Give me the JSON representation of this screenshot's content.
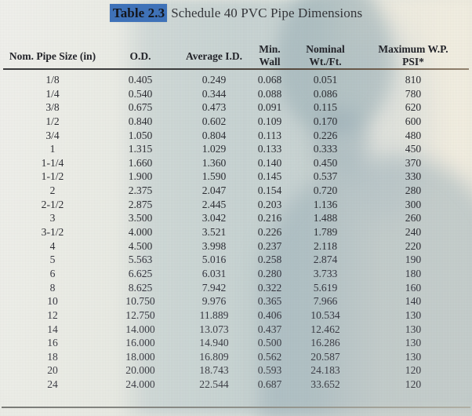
{
  "document": {
    "title_tag": "Table 2.3",
    "title_rest": "Schedule 40 PVC Pipe Dimensions",
    "highlight_color": "#3f72b8",
    "rule_color": "#2a2b2c"
  },
  "table": {
    "columns": [
      {
        "id": "size",
        "label": "Nom. Pipe Size (in)",
        "label_line1": "Nom. Pipe Size (in)",
        "label_line2": ""
      },
      {
        "id": "od",
        "label": "O.D.",
        "label_line1": "O.D.",
        "label_line2": ""
      },
      {
        "id": "id",
        "label": "Average I.D.",
        "label_line1": "Average I.D.",
        "label_line2": ""
      },
      {
        "id": "wall",
        "label": "Min. Wall",
        "label_line1": "Min.",
        "label_line2": "Wall"
      },
      {
        "id": "wt",
        "label": "Nominal Wt./Ft.",
        "label_line1": "Nominal",
        "label_line2": "Wt./Ft."
      },
      {
        "id": "psi",
        "label": "Maximum W.P. PSI*",
        "label_line1": "Maximum W.P.",
        "label_line2": "PSI*"
      }
    ],
    "rows": [
      {
        "size": "1/8",
        "od": "0.405",
        "id": "0.249",
        "wall": "0.068",
        "wt": "0.051",
        "psi": "810"
      },
      {
        "size": "1/4",
        "od": "0.540",
        "id": "0.344",
        "wall": "0.088",
        "wt": "0.086",
        "psi": "780"
      },
      {
        "size": "3/8",
        "od": "0.675",
        "id": "0.473",
        "wall": "0.091",
        "wt": "0.115",
        "psi": "620"
      },
      {
        "size": "1/2",
        "od": "0.840",
        "id": "0.602",
        "wall": "0.109",
        "wt": "0.170",
        "psi": "600"
      },
      {
        "size": "3/4",
        "od": "1.050",
        "id": "0.804",
        "wall": "0.113",
        "wt": "0.226",
        "psi": "480"
      },
      {
        "size": "1",
        "od": "1.315",
        "id": "1.029",
        "wall": "0.133",
        "wt": "0.333",
        "psi": "450"
      },
      {
        "size": "1-1/4",
        "od": "1.660",
        "id": "1.360",
        "wall": "0.140",
        "wt": "0.450",
        "psi": "370"
      },
      {
        "size": "1-1/2",
        "od": "1.900",
        "id": "1.590",
        "wall": "0.145",
        "wt": "0.537",
        "psi": "330"
      },
      {
        "size": "2",
        "od": "2.375",
        "id": "2.047",
        "wall": "0.154",
        "wt": "0.720",
        "psi": "280"
      },
      {
        "size": "2-1/2",
        "od": "2.875",
        "id": "2.445",
        "wall": "0.203",
        "wt": "1.136",
        "psi": "300"
      },
      {
        "size": "3",
        "od": "3.500",
        "id": "3.042",
        "wall": "0.216",
        "wt": "1.488",
        "psi": "260"
      },
      {
        "size": "3-1/2",
        "od": "4.000",
        "id": "3.521",
        "wall": "0.226",
        "wt": "1.789",
        "psi": "240"
      },
      {
        "size": "4",
        "od": "4.500",
        "id": "3.998",
        "wall": "0.237",
        "wt": "2.118",
        "psi": "220"
      },
      {
        "size": "5",
        "od": "5.563",
        "id": "5.016",
        "wall": "0.258",
        "wt": "2.874",
        "psi": "190"
      },
      {
        "size": "6",
        "od": "6.625",
        "id": "6.031",
        "wall": "0.280",
        "wt": "3.733",
        "psi": "180"
      },
      {
        "size": "8",
        "od": "8.625",
        "id": "7.942",
        "wall": "0.322",
        "wt": "5.619",
        "psi": "160"
      },
      {
        "size": "10",
        "od": "10.750",
        "id": "9.976",
        "wall": "0.365",
        "wt": "7.966",
        "psi": "140"
      },
      {
        "size": "12",
        "od": "12.750",
        "id": "11.889",
        "wall": "0.406",
        "wt": "10.534",
        "psi": "130"
      },
      {
        "size": "14",
        "od": "14.000",
        "id": "13.073",
        "wall": "0.437",
        "wt": "12.462",
        "psi": "130"
      },
      {
        "size": "16",
        "od": "16.000",
        "id": "14.940",
        "wall": "0.500",
        "wt": "16.286",
        "psi": "130"
      },
      {
        "size": "18",
        "od": "18.000",
        "id": "16.809",
        "wall": "0.562",
        "wt": "20.587",
        "psi": "130"
      },
      {
        "size": "20",
        "od": "20.000",
        "id": "18.743",
        "wall": "0.593",
        "wt": "24.183",
        "psi": "120"
      },
      {
        "size": "24",
        "od": "24.000",
        "id": "22.544",
        "wall": "0.687",
        "wt": "33.652",
        "psi": "120"
      }
    ]
  }
}
